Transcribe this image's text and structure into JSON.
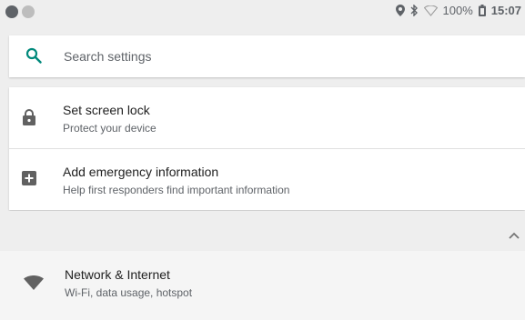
{
  "status_bar": {
    "battery": "100%",
    "time": "15:07",
    "icons": [
      "app-dot-icon",
      "app-dot-icon",
      "location-icon",
      "bluetooth-icon",
      "wifi-outline-icon",
      "battery-icon"
    ]
  },
  "search": {
    "placeholder": "Search settings",
    "icon": "search-icon",
    "accent": "#00897b"
  },
  "suggestions": [
    {
      "title": "Set screen lock",
      "subtitle": "Protect your device",
      "icon": "lock-icon"
    },
    {
      "title": "Add emergency information",
      "subtitle": "Help first responders find important information",
      "icon": "add-box-icon"
    }
  ],
  "collapse": {
    "icon": "chevron-up-icon"
  },
  "settings": [
    {
      "title": "Network & Internet",
      "subtitle": "Wi-Fi, data usage, hotspot",
      "icon": "wifi-icon"
    }
  ]
}
